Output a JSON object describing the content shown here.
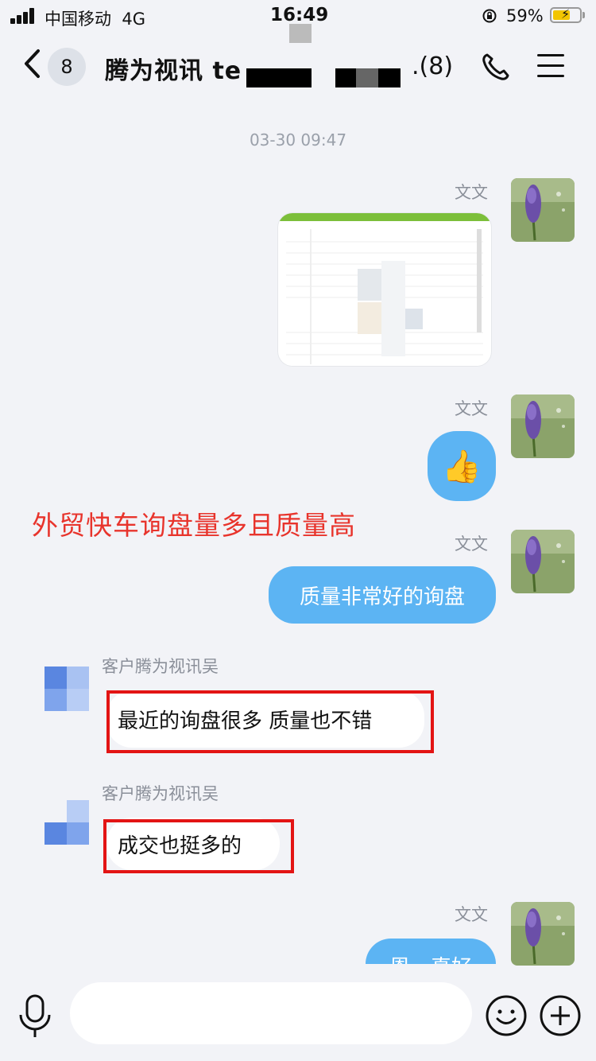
{
  "status_bar": {
    "carrier": "中国移动",
    "network": "4G",
    "time": "16:49",
    "battery_percent": "59%"
  },
  "header": {
    "back_badge_count": "8",
    "title": "腾为视讯 te",
    "title_suffix": ".(8)"
  },
  "chat": {
    "timestamp": "03-30 09:47",
    "messages": [
      {
        "sender": "文文",
        "type": "image",
        "side": "right"
      },
      {
        "sender": "文文",
        "type": "emoji",
        "content": "👍",
        "side": "right"
      },
      {
        "sender": "文文",
        "type": "text",
        "content": "质量非常好的询盘",
        "side": "right"
      },
      {
        "sender": "客户腾为视讯吴",
        "type": "text",
        "content": "最近的询盘很多 质量也不错",
        "side": "left"
      },
      {
        "sender": "客户腾为视讯吴",
        "type": "text",
        "content": "成交也挺多的",
        "side": "left"
      },
      {
        "sender": "文文",
        "type": "text",
        "content": "恩，真好",
        "side": "right"
      }
    ]
  },
  "annotation": "外贸快车询盘量多且质量高",
  "colors": {
    "bubble_blue": "#5cb4f3",
    "highlight_red": "#e31414",
    "annotation_red": "#e8342c",
    "background": "#f2f3f7"
  },
  "icons": [
    "back-icon",
    "phone-icon",
    "menu-icon",
    "mic-icon",
    "emoji-icon",
    "plus-icon"
  ]
}
